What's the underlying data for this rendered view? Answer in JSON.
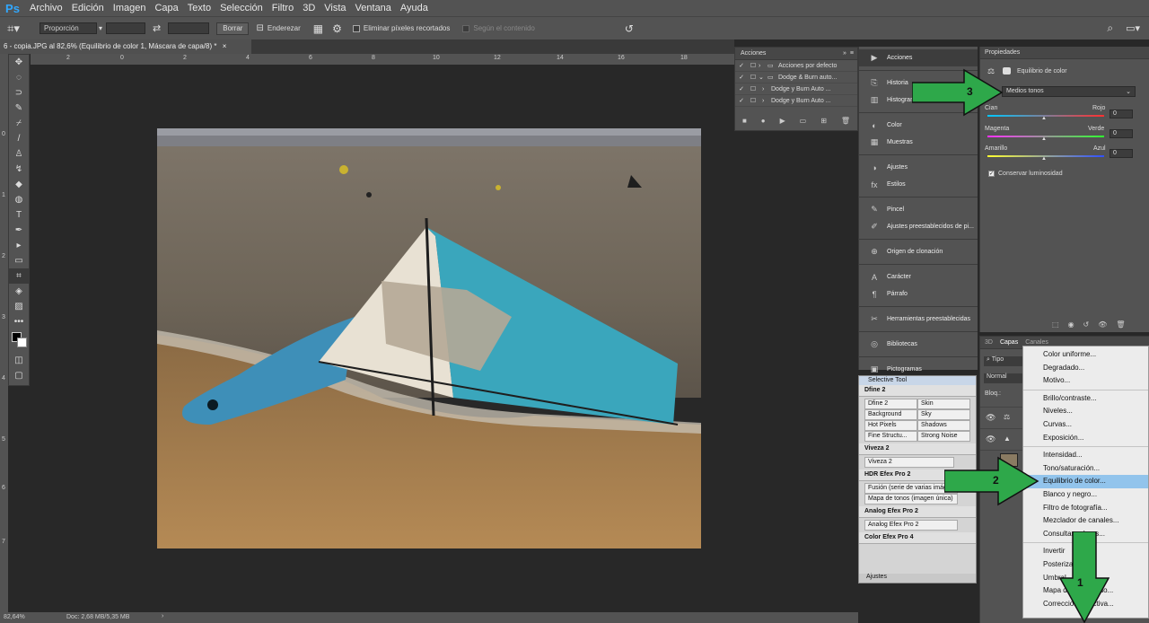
{
  "menubar": {
    "logo": "Ps",
    "items": [
      "Archivo",
      "Edición",
      "Imagen",
      "Capa",
      "Texto",
      "Selección",
      "Filtro",
      "3D",
      "Vista",
      "Ventana",
      "Ayuda"
    ]
  },
  "options": {
    "ratio": "Proporción",
    "borrar": "Borrar",
    "enderezar": "Enderezar",
    "eliminar": "Eliminar píxeles recortados",
    "segun": "Según el contenido"
  },
  "document": {
    "tab_title": "6 - copia.JPG al 82,6% (Equilibrio de color 1, Máscara de capa/8) *",
    "close": "×"
  },
  "status": {
    "zoom": "82,64%",
    "doc": "Doc: 2,68 MB/5,35 MB",
    "arrow": "›"
  },
  "ruler": {
    "top": [
      "2",
      "0",
      "2",
      "4",
      "6",
      "8",
      "10",
      "12",
      "14",
      "16",
      "18"
    ],
    "left": [
      "0",
      "1",
      "2",
      "3",
      "4",
      "5",
      "6",
      "7"
    ]
  },
  "acciones": {
    "title": "Acciones",
    "rows": [
      "Acciones por defecto",
      "Dodge & Burn auto...",
      "Dodge y Burn Auto ...",
      "Dodge y Burn Auto ..."
    ]
  },
  "dock": {
    "items": [
      {
        "label": "Acciones",
        "icon": "▶"
      },
      {
        "label": "Historia",
        "icon": "⎘"
      },
      {
        "label": "Histograma",
        "icon": "▥"
      },
      {
        "label": "Color",
        "icon": "◐"
      },
      {
        "label": "Muestras",
        "icon": "▦"
      },
      {
        "label": "Ajustes",
        "icon": "◑"
      },
      {
        "label": "Estilos",
        "icon": "fx"
      },
      {
        "label": "Pincel",
        "icon": "✎"
      },
      {
        "label": "Ajustes preestablecidos de pi...",
        "icon": "✐"
      },
      {
        "label": "Origen de clonación",
        "icon": "⊕"
      },
      {
        "label": "Carácter",
        "icon": "A"
      },
      {
        "label": "Párrafo",
        "icon": "¶"
      },
      {
        "label": "Herramientas preestablecidas",
        "icon": "✂"
      },
      {
        "label": "Bibliotecas",
        "icon": "◎"
      },
      {
        "label": "Pictogramas",
        "icon": "▣"
      }
    ]
  },
  "selective": {
    "title": "Selective Tool",
    "dfine_head": "Dfine 2",
    "dfine": [
      "Dfine 2",
      "Skin",
      "Background",
      "Sky",
      "Hot Pixels",
      "Shadows",
      "Fine Structu...",
      "Strong Noise"
    ],
    "viveza_head": "Viveza 2",
    "viveza": "Viveza 2",
    "hdr_head": "HDR Efex Pro 2",
    "hdr": [
      "Fusión (serie de varias imág...",
      "Mapa de tonos (imagen única)"
    ],
    "analog_head": "Analog Efex Pro 2",
    "analog": "Analog Efex Pro 2",
    "color_head": "Color Efex Pro 4",
    "ajustes": "Ajustes"
  },
  "properties": {
    "title": "Propiedades",
    "adjust_name": "Equilibrio de color",
    "tone": "Medios tonos",
    "sliders": [
      {
        "left": "Cian",
        "right": "Rojo",
        "value": "0",
        "colors": [
          "#00c8ff",
          "#ff3030"
        ]
      },
      {
        "left": "Magenta",
        "right": "Verde",
        "value": "0",
        "colors": [
          "#ff30ff",
          "#30ff30"
        ]
      },
      {
        "left": "Amarillo",
        "right": "Azul",
        "value": "0",
        "colors": [
          "#ffff30",
          "#3050ff"
        ]
      }
    ],
    "preserve": "Conservar luminosidad"
  },
  "layers": {
    "tabs": [
      "3D",
      "Capas",
      "Canales"
    ],
    "kind": "Tipo",
    "mode": "Normal",
    "lock": "Bloq.:"
  },
  "dropdown": {
    "group1": [
      "Color uniforme...",
      "Degradado...",
      "Motivo..."
    ],
    "group2": [
      "Brillo/contraste...",
      "Niveles...",
      "Curvas...",
      "Exposición..."
    ],
    "group3": [
      "Intensidad...",
      "Tono/saturación...",
      "Equilibrio de color...",
      "Blanco y negro...",
      "Filtro de fotografía...",
      "Mezclador de canales...",
      "Consultar colores..."
    ],
    "group4": [
      "Invertir",
      "Posterizar...",
      "Umbral...",
      "Mapa de degradado...",
      "Corrección selectiva..."
    ],
    "highlight": "Equilibrio de color..."
  },
  "arrows": {
    "one": "1",
    "two": "2",
    "three": "3",
    "color": "#2ea84a"
  }
}
